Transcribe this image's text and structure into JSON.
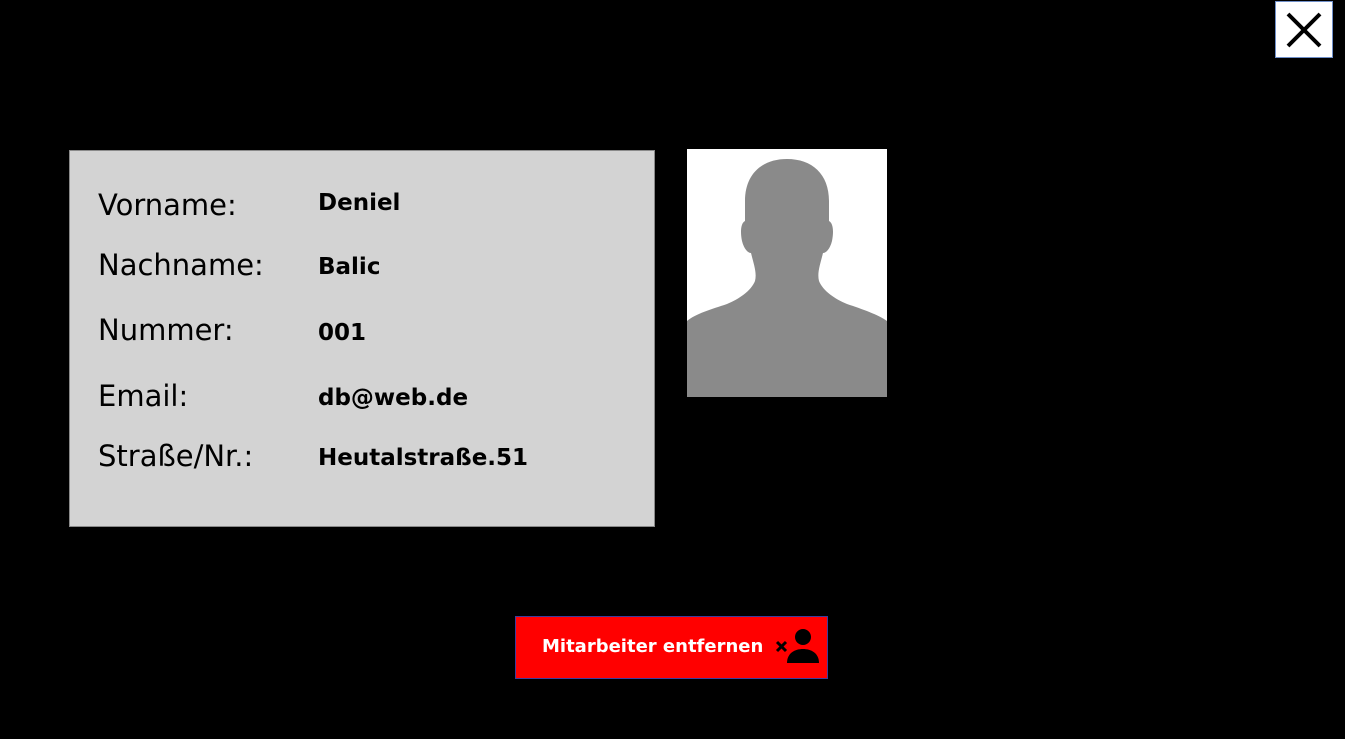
{
  "window": {
    "background": "#000000"
  },
  "close_button": {
    "icon": "close-icon"
  },
  "employee": {
    "fields": [
      {
        "label": "Vorname:",
        "value": "Deniel"
      },
      {
        "label": "Nachname:",
        "value": "Balic"
      },
      {
        "label": "Nummer:",
        "value": "001"
      },
      {
        "label": "Email:",
        "value": "db@web.de"
      },
      {
        "label": "Straße/Nr.:",
        "value": "Heutalstraße.51"
      }
    ],
    "photo_icon": "person-silhouette-icon"
  },
  "remove_button": {
    "label": "Mitarbeiter entfernen",
    "icon": "remove-user-icon",
    "color": "#ff0000"
  }
}
